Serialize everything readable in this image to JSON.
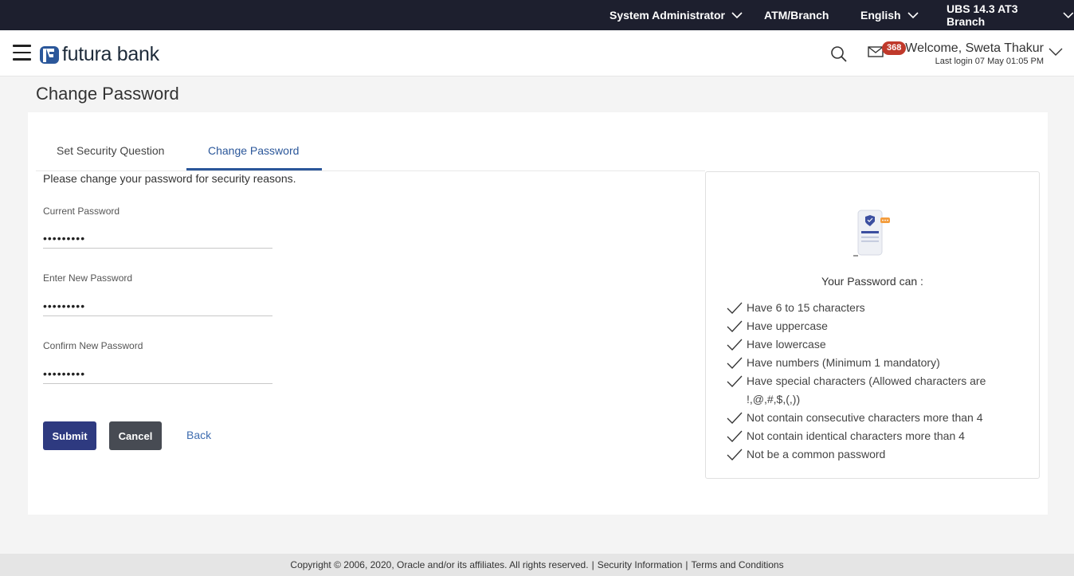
{
  "topbar": {
    "role": "System Administrator",
    "entity": "ATM/Branch",
    "language": "English",
    "system": "UBS 14.3 AT3 Branch"
  },
  "header": {
    "brand": "futura bank",
    "notification_count": "368",
    "welcome": "Welcome, Sweta Thakur",
    "last_login": "Last login 07 May 01:05 PM"
  },
  "page": {
    "title": "Change Password"
  },
  "tabs": [
    {
      "label": "Set Security Question"
    },
    {
      "label": "Change Password"
    }
  ],
  "form": {
    "intro": "Please change your password for security reasons.",
    "current_label": "Current Password",
    "current_value": "•••••••••",
    "new_label": "Enter New Password",
    "new_value": "•••••••••",
    "confirm_label": "Confirm New Password",
    "confirm_value": "•••••••••",
    "submit": "Submit",
    "cancel": "Cancel",
    "back": "Back"
  },
  "rules": {
    "title": "Your Password can :",
    "items": [
      "Have 6 to 15 characters",
      "Have uppercase",
      "Have lowercase",
      "Have numbers (Minimum 1 mandatory)",
      "Have special characters (Allowed characters are !,@,#,$,(,))",
      "Not contain consecutive characters more than 4",
      "Not contain identical characters more than 4",
      "Not be a common password"
    ]
  },
  "footer": {
    "copyright": "Copyright © 2006, 2020, Oracle and/or its affiliates. All rights reserved.",
    "security": "Security Information",
    "terms": "Terms and Conditions",
    "sep": "|"
  },
  "colors": {
    "topbar": "#1d1f2e",
    "accent": "#2b579a",
    "submit": "#2e3a80",
    "cancel": "#474b53",
    "badge": "#c0392b"
  }
}
